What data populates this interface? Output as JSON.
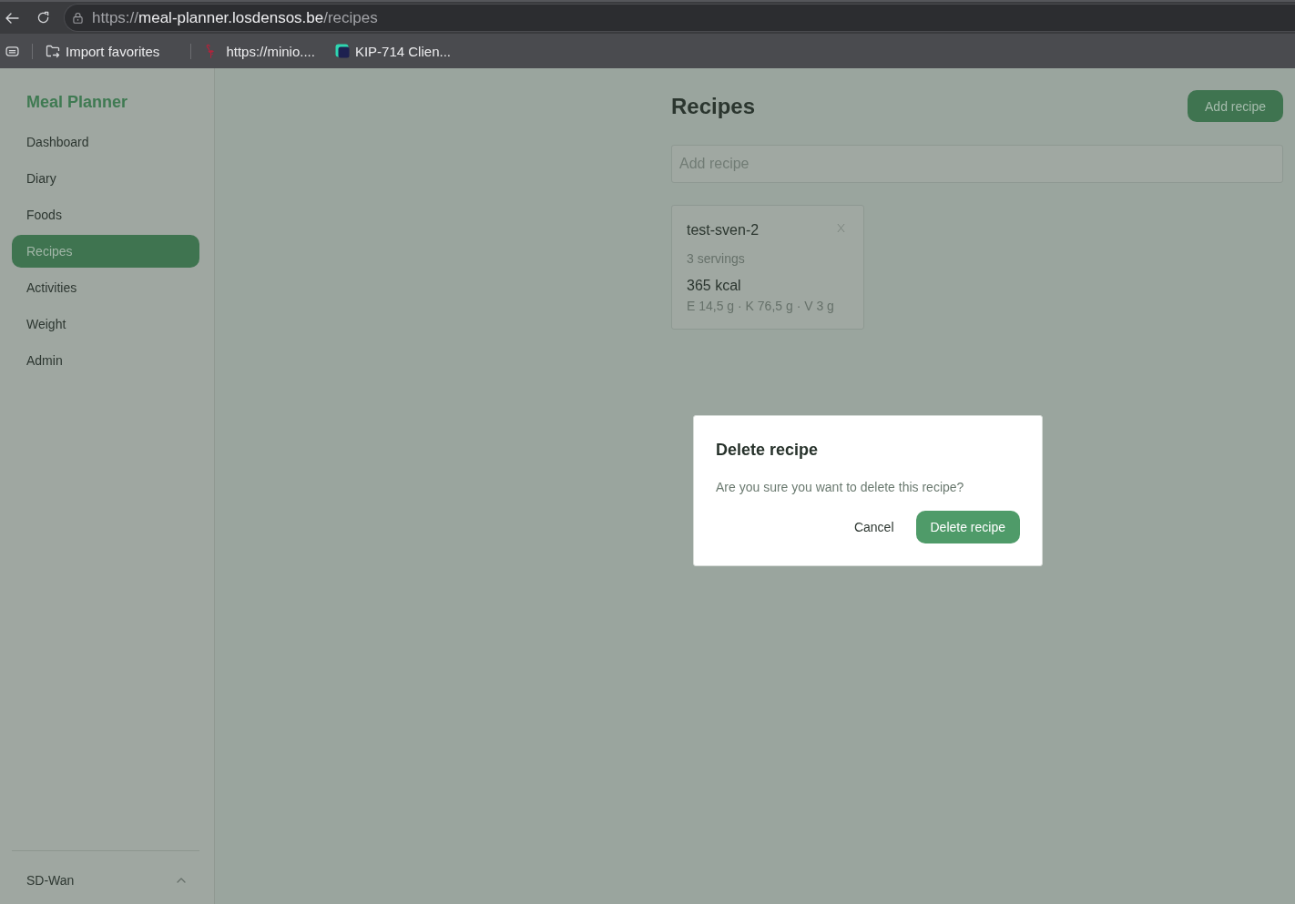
{
  "browser": {
    "url": {
      "scheme": "https://",
      "host": "meal-planner.losdensos.be",
      "path": "/recipes"
    },
    "bookmarks": [
      {
        "label": "Import favorites",
        "kind": "import"
      },
      {
        "label": "https://minio....",
        "kind": "flamingo"
      },
      {
        "label": "KIP-714 Clien...",
        "kind": "square"
      }
    ]
  },
  "sidebar": {
    "title": "Meal Planner",
    "items": [
      {
        "label": "Dashboard",
        "selected": false
      },
      {
        "label": "Diary",
        "selected": false
      },
      {
        "label": "Foods",
        "selected": false
      },
      {
        "label": "Recipes",
        "selected": true
      },
      {
        "label": "Activities",
        "selected": false
      },
      {
        "label": "Weight",
        "selected": false
      },
      {
        "label": "Admin",
        "selected": false
      }
    ],
    "footer": {
      "label": "SD-Wan"
    }
  },
  "page": {
    "title": "Recipes",
    "add_button": "Add recipe",
    "search": {
      "placeholder": "Add recipe"
    },
    "recipes": [
      {
        "name": "test-sven-2",
        "servings": "3 servings",
        "kcal": "365 kcal",
        "macros": "E 14,5 g · K 76,5 g · V 3 g"
      }
    ]
  },
  "dialog": {
    "title": "Delete recipe",
    "message": "Are you sure you want to delete this recipe?",
    "buttons": [
      {
        "label": "Cancel",
        "kind": "secondary"
      },
      {
        "label": "Delete recipe",
        "kind": "primary"
      }
    ]
  }
}
